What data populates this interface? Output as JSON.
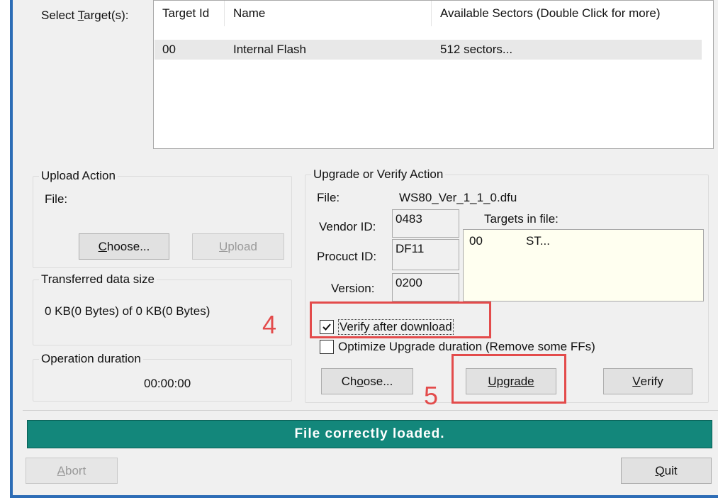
{
  "targets": {
    "label_pre": "Select ",
    "label_accel": "T",
    "label_post": "arget(s):",
    "columns": [
      "Target Id",
      "Name",
      "Available Sectors (Double Click for more)"
    ],
    "rows": [
      {
        "id": "00",
        "name": "Internal Flash",
        "sectors": "512 sectors..."
      }
    ]
  },
  "upload_action": {
    "title": "Upload Action",
    "file_label": "File:",
    "choose_accel": "C",
    "choose_rest": "hoose...",
    "upload_accel": "U",
    "upload_rest": "pload"
  },
  "transferred": {
    "title": "Transferred data size",
    "value": "0 KB(0 Bytes) of 0 KB(0 Bytes)"
  },
  "operation": {
    "title": "Operation duration",
    "value": "00:00:00"
  },
  "upgrade_action": {
    "title": "Upgrade or Verify Action",
    "file_label": "File:",
    "file_value": "WS80_Ver_1_1_0.dfu",
    "vendor_label": "Vendor ID:",
    "vendor_value": "0483",
    "product_label": "Procuct ID:",
    "product_value": "DF11",
    "version_label": "Version:",
    "version_value": "0200",
    "targets_in_file_label": "Targets in file:",
    "targets_in_file": [
      {
        "id": "00",
        "name": "ST..."
      }
    ],
    "verify_after_download": "Verify after download",
    "verify_after_download_checked": true,
    "optimize_upgrade": "Optimize Upgrade duration (Remove some FFs)",
    "optimize_upgrade_checked": false,
    "choose_pre": "Ch",
    "choose_accel": "o",
    "choose_post": "ose...",
    "upgrade_label": "Upgrade",
    "verify_accel": "V",
    "verify_rest": "erify"
  },
  "annotations": {
    "step4": "4",
    "step5": "5",
    "color": "#e34b4b"
  },
  "status": {
    "text": "File correctly loaded.",
    "color": "#13877b"
  },
  "bottom": {
    "abort_accel": "A",
    "abort_rest": "bort",
    "quit_accel": "Q",
    "quit_rest": "uit"
  }
}
